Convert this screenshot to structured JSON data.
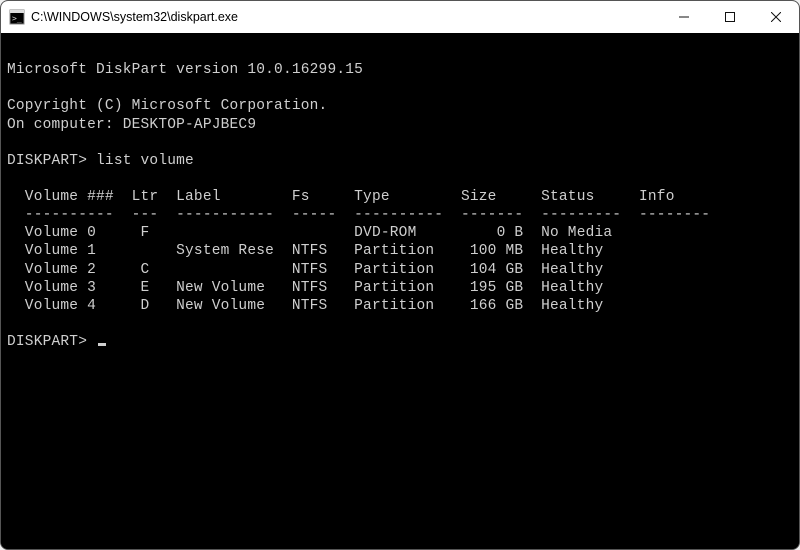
{
  "window": {
    "title": "C:\\WINDOWS\\system32\\diskpart.exe"
  },
  "terminal": {
    "version_line": "Microsoft DiskPart version 10.0.16299.15",
    "copyright_line": "Copyright (C) Microsoft Corporation.",
    "computer_line": "On computer: DESKTOP-APJBEC9",
    "prompt1_prefix": "DISKPART> ",
    "command1": "list volume",
    "header": "  Volume ###  Ltr  Label        Fs     Type        Size     Status     Info",
    "divider": "  ----------  ---  -----------  -----  ----------  -------  ---------  --------",
    "rows": [
      "  Volume 0     F                       DVD-ROM         0 B  No Media",
      "  Volume 1         System Rese  NTFS   Partition    100 MB  Healthy",
      "  Volume 2     C                NTFS   Partition    104 GB  Healthy",
      "  Volume 3     E   New Volume   NTFS   Partition    195 GB  Healthy",
      "  Volume 4     D   New Volume   NTFS   Partition    166 GB  Healthy"
    ],
    "prompt2_prefix": "DISKPART> "
  },
  "volumes_structured": [
    {
      "num": 0,
      "ltr": "F",
      "label": "",
      "fs": "",
      "type": "DVD-ROM",
      "size": "0 B",
      "status": "No Media",
      "info": ""
    },
    {
      "num": 1,
      "ltr": "",
      "label": "System Rese",
      "fs": "NTFS",
      "type": "Partition",
      "size": "100 MB",
      "status": "Healthy",
      "info": ""
    },
    {
      "num": 2,
      "ltr": "C",
      "label": "",
      "fs": "NTFS",
      "type": "Partition",
      "size": "104 GB",
      "status": "Healthy",
      "info": ""
    },
    {
      "num": 3,
      "ltr": "E",
      "label": "New Volume",
      "fs": "NTFS",
      "type": "Partition",
      "size": "195 GB",
      "status": "Healthy",
      "info": ""
    },
    {
      "num": 4,
      "ltr": "D",
      "label": "New Volume",
      "fs": "NTFS",
      "type": "Partition",
      "size": "166 GB",
      "status": "Healthy",
      "info": ""
    }
  ]
}
